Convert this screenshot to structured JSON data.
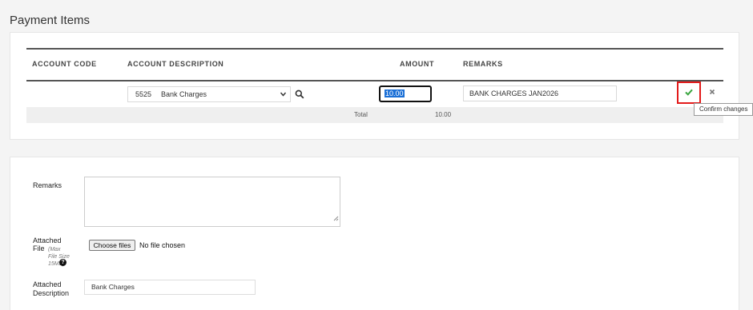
{
  "section_title": "Payment Items",
  "table": {
    "headers": {
      "account_code": "ACCOUNT CODE",
      "account_description": "ACCOUNT DESCRIPTION",
      "amount": "AMOUNT",
      "remarks": "REMARKS"
    },
    "row": {
      "account_select": {
        "code": "5525",
        "name": "Bank Charges"
      },
      "amount_value": "10.00",
      "remarks_value": "BANK CHARGES JAN2026"
    },
    "total": {
      "label": "Total",
      "value": "10.00"
    }
  },
  "actions": {
    "confirm_tooltip": "Confirm changes",
    "confirm_icon": "check-icon",
    "cancel_icon": "close-icon",
    "accent_color": "#3aa640",
    "highlight_color": "#e31b1b"
  },
  "form": {
    "remarks_label": "Remarks",
    "remarks_value": "",
    "attached_file_label_1": "Attached",
    "attached_file_label_2": "File",
    "max_size_note": "(Max File Size 15MB)",
    "choose_files_label": "Choose files",
    "no_file_text": "No file chosen",
    "attached_description_label_1": "Attached",
    "attached_description_label_2": "Description",
    "attached_description_value": "Bank Charges"
  }
}
